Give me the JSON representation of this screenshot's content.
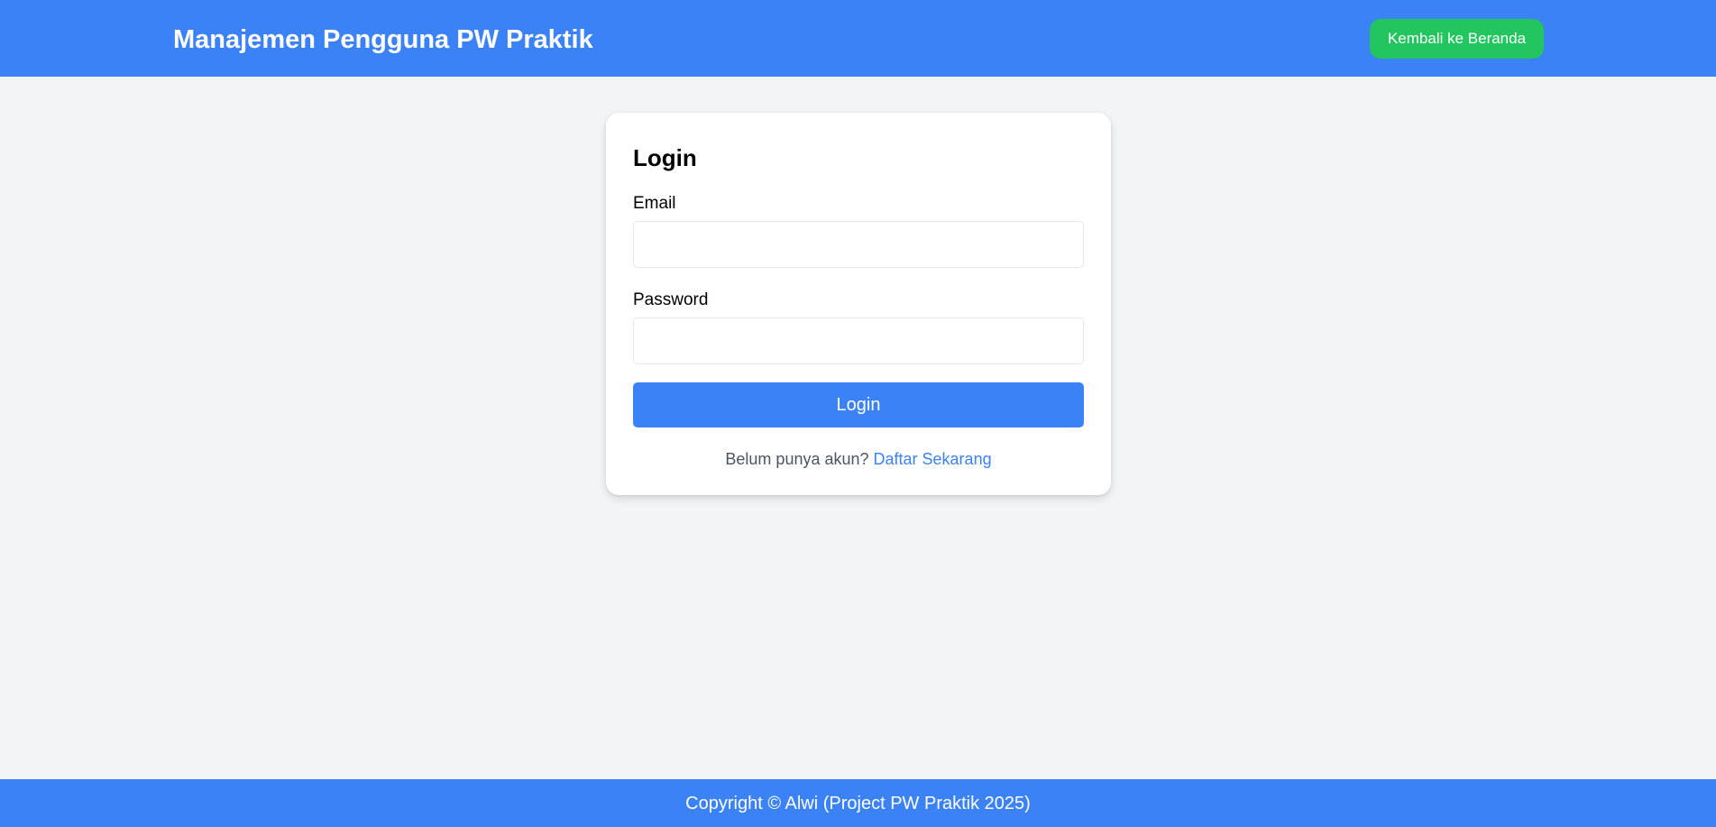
{
  "header": {
    "title": "Manajemen Pengguna PW Praktik",
    "home_button_label": "Kembali ke Beranda"
  },
  "login_form": {
    "title": "Login",
    "email_label": "Email",
    "email_value": "",
    "email_placeholder": "",
    "password_label": "Password",
    "password_value": "",
    "password_placeholder": "",
    "submit_label": "Login",
    "register_prompt": "Belum punya akun?",
    "register_link": "Daftar Sekarang"
  },
  "footer": {
    "text": "Copyright © Alwi (Project PW Praktik 2025)"
  },
  "colors": {
    "primary": "#3b82f6",
    "success": "#22c55e",
    "background": "#f3f4f6",
    "card": "#ffffff"
  }
}
